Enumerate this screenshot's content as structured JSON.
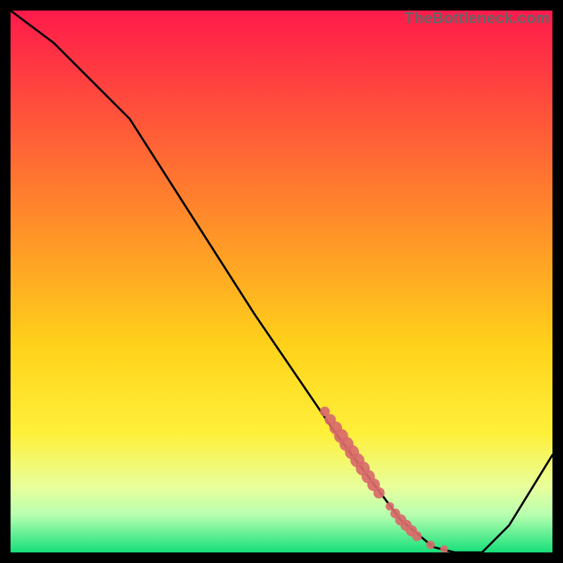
{
  "watermark": "TheBottleneck.com",
  "colors": {
    "grad_top": "#ff1a4b",
    "grad_mid1": "#ff6a2e",
    "grad_mid2": "#ffd21a",
    "grad_mid3": "#fff03a",
    "grad_band": "#e8ff9c",
    "grad_bottom": "#15e07a",
    "line": "#000000",
    "marker": "#d86a6a",
    "frame": "#000000"
  },
  "chart_data": {
    "type": "line",
    "title": "",
    "xlabel": "",
    "ylabel": "",
    "xlim": [
      0,
      100
    ],
    "ylim": [
      0,
      100
    ],
    "series": [
      {
        "name": "curve",
        "x": [
          0,
          8,
          15,
          22,
          45,
          60,
          72,
          78,
          82,
          87,
          92,
          100
        ],
        "y": [
          100,
          94,
          87,
          80,
          44,
          22,
          6,
          1,
          0,
          0,
          5,
          18
        ]
      }
    ],
    "markers": {
      "name": "highlight-cluster",
      "points": [
        {
          "x": 58,
          "y": 26,
          "r": 1.4
        },
        {
          "x": 59,
          "y": 24.5,
          "r": 1.6
        },
        {
          "x": 60,
          "y": 23,
          "r": 1.8
        },
        {
          "x": 61,
          "y": 21.5,
          "r": 2.0
        },
        {
          "x": 62,
          "y": 20,
          "r": 2.0
        },
        {
          "x": 63,
          "y": 18.5,
          "r": 2.0
        },
        {
          "x": 64,
          "y": 17,
          "r": 2.0
        },
        {
          "x": 65,
          "y": 15.5,
          "r": 2.0
        },
        {
          "x": 66,
          "y": 14,
          "r": 1.9
        },
        {
          "x": 67,
          "y": 12.5,
          "r": 1.8
        },
        {
          "x": 68,
          "y": 11,
          "r": 1.6
        },
        {
          "x": 70,
          "y": 8.5,
          "r": 1.2
        },
        {
          "x": 71,
          "y": 7.2,
          "r": 1.4
        },
        {
          "x": 72,
          "y": 6,
          "r": 1.6
        },
        {
          "x": 73,
          "y": 5,
          "r": 1.6
        },
        {
          "x": 74,
          "y": 4,
          "r": 1.6
        },
        {
          "x": 75,
          "y": 3,
          "r": 1.4
        },
        {
          "x": 77.5,
          "y": 1.4,
          "r": 1.2
        },
        {
          "x": 80,
          "y": 0.6,
          "r": 1.1
        }
      ]
    }
  }
}
